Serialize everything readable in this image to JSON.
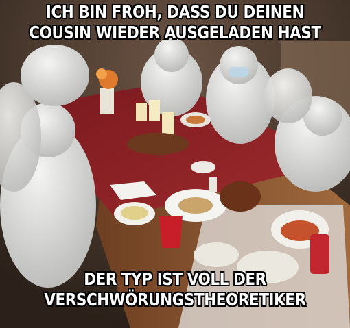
{
  "meme": {
    "top_text": [
      "ICH BIN FROH, DASS DU DEINEN",
      "COUSIN WIEDER AUSGELADEN HAST"
    ],
    "bottom_text": [
      "DER TYP IST VOLL DER",
      "VERSCHWÖRUNGSTHEORETIKER"
    ]
  },
  "colors": {
    "tablecloth": "#8e1f24",
    "wood_table": "#8a5430",
    "hazmat_suit": "#e4e4e2",
    "background": "#3e2f24",
    "caption_text": "#ffffff",
    "caption_outline": "#000000"
  }
}
